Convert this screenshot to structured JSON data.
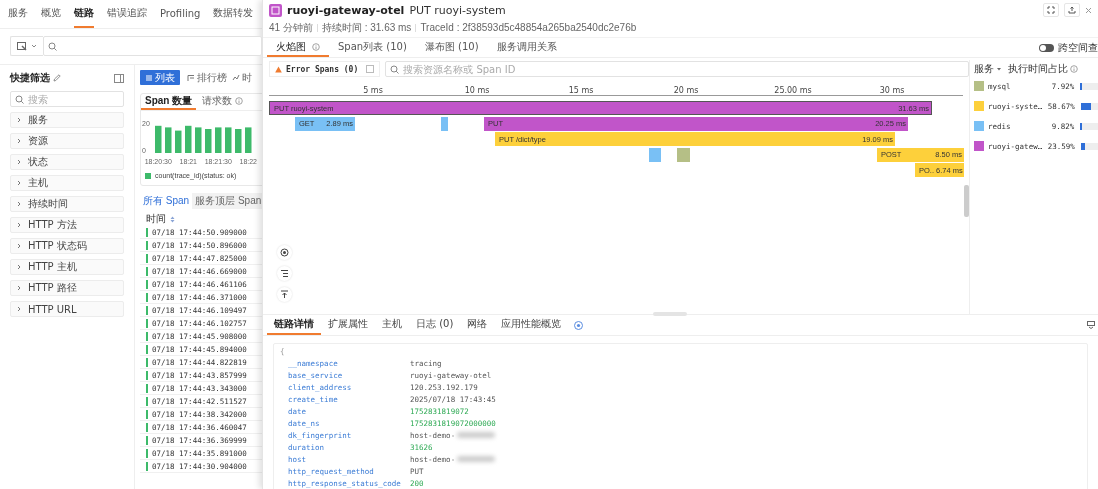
{
  "nav": {
    "tabs": [
      {
        "label": "服务",
        "selected": false
      },
      {
        "label": "概览",
        "selected": false
      },
      {
        "label": "链路",
        "selected": true
      },
      {
        "label": "错误追踪",
        "selected": false
      },
      {
        "label": "Profiling",
        "selected": false
      },
      {
        "label": "数据转发",
        "selected": false
      }
    ]
  },
  "quick_filter": {
    "title": "快捷筛选",
    "search_placeholder": "搜索",
    "items": [
      {
        "label": "服务",
        "expanded": false
      },
      {
        "label": "资源",
        "expanded": false
      },
      {
        "label": "状态",
        "expanded": false
      },
      {
        "label": "主机",
        "expanded": false
      },
      {
        "label": "持续时间",
        "expanded": false
      },
      {
        "label": "HTTP 方法",
        "expanded": false
      },
      {
        "label": "HTTP 状态码",
        "expanded": false
      },
      {
        "label": "HTTP 主机",
        "expanded": false
      },
      {
        "label": "HTTP 路径",
        "expanded": false
      },
      {
        "label": "HTTP URL",
        "expanded": false
      }
    ]
  },
  "view_buttons": [
    {
      "label": "列表",
      "selected": true
    },
    {
      "label": "排行榜",
      "selected": false
    },
    {
      "label": "时",
      "selected": false
    }
  ],
  "chart_card": {
    "tabs": [
      {
        "label": "Span 数量",
        "selected": true
      },
      {
        "label": "请求数",
        "selected": false
      }
    ],
    "chart_data": {
      "type": "bar",
      "categories": [
        "18:20:30",
        null,
        null,
        "18:21",
        null,
        null,
        "18:21:30",
        null,
        null,
        "18:22"
      ],
      "yticks": [
        0,
        20
      ],
      "ylim": [
        0,
        20
      ],
      "series": [
        {
          "name": "count(trace_id)(status: ok)",
          "color": "#3dba6a",
          "values": [
            17,
            16,
            14,
            17,
            16,
            15,
            16,
            16,
            15,
            16
          ]
        }
      ]
    }
  },
  "span_table": {
    "tabs": [
      {
        "label": "所有 Span",
        "selected": true
      },
      {
        "label": "服务顶层 Span",
        "selected": false
      }
    ],
    "columns": [
      "时间"
    ],
    "rows": [
      "07/18 17:44:50.909000",
      "07/18 17:44:50.896000",
      "07/18 17:44:47.825000",
      "07/18 17:44:46.669000",
      "07/18 17:44:46.461106",
      "07/18 17:44:46.371000",
      "07/18 17:44:46.109497",
      "07/18 17:44:46.102757",
      "07/18 17:44:45.908000",
      "07/18 17:44:45.894000",
      "07/18 17:44:44.822819",
      "07/18 17:44:43.857999",
      "07/18 17:44:43.343000",
      "07/18 17:44:42.511527",
      "07/18 17:44:38.342000",
      "07/18 17:44:36.460047",
      "07/18 17:44:36.369999",
      "07/18 17:44:35.891000",
      "07/18 17:44:30.904000"
    ]
  },
  "trace": {
    "service": "ruoyi-gateway-otel",
    "resource": "PUT ruoyi-system",
    "meta": [
      "41 分钟前",
      "持续时间 : 31.63 ms",
      "TraceId : 2f38593d5c48854a265ba2540dc2e76b"
    ],
    "tabs": [
      {
        "label": "火焰图",
        "selected": true
      },
      {
        "label": "Span列表 (10)",
        "selected": false
      },
      {
        "label": "瀑布图 (10)",
        "selected": false
      },
      {
        "label": "服务调用关系",
        "selected": false
      }
    ],
    "cross_space": {
      "label": "跨空间查",
      "on": false
    }
  },
  "flame": {
    "error_spans": {
      "label": "Error Spans (0)",
      "checked": false
    },
    "search_placeholder": "搜索资源名称或 Span ID",
    "ticks": [
      "5 ms",
      "10 ms",
      "15 ms",
      "20 ms",
      "25.00 ms",
      "30 ms"
    ],
    "spans": [
      {
        "label": "PUT ruoyi-system",
        "duration": "31.63 ms",
        "color": "#c155c9",
        "children": [
          {
            "label": "GET",
            "duration": "2.89 ms",
            "color": "#79c0f5"
          },
          {
            "color": "#79c0f5"
          },
          {
            "label": "PUT",
            "duration": "20.25 ms",
            "color": "#c155c9",
            "children": [
              {
                "label": "PUT /dict/type",
                "duration": "19.09 ms",
                "color": "#fdd03b",
                "children": [
                  {
                    "color": "#79c0f5"
                  },
                  {
                    "color": "#b5bf86"
                  },
                  {
                    "label": "POST",
                    "duration": "8.50 ms",
                    "color": "#fdd03b",
                    "children": [
                      {
                        "label": "PO..",
                        "duration": "6.74 ms",
                        "color": "#fdd03b"
                      }
                    ]
                  }
                ]
              }
            ]
          }
        ]
      }
    ]
  },
  "services": {
    "columns": [
      "服务",
      "执行时间占比"
    ],
    "rows": [
      {
        "name": "mysql",
        "share": "7.92%",
        "level": 0.0792,
        "color": "#b5bf86"
      },
      {
        "name": "ruoyi-syste…",
        "share": "58.67%",
        "level": 0.5867,
        "color": "#fdd03b"
      },
      {
        "name": "redis",
        "share": "9.82%",
        "level": 0.0982,
        "color": "#79c0f5"
      },
      {
        "name": "ruoyi-gatew…",
        "share": "23.59%",
        "level": 0.2359,
        "color": "#c155c9"
      }
    ]
  },
  "details": {
    "tabs": [
      {
        "label": "链路详情",
        "selected": true
      },
      {
        "label": "扩展属性",
        "selected": false
      },
      {
        "label": "主机",
        "selected": false
      },
      {
        "label": "日志 (0)",
        "selected": false
      },
      {
        "label": "网络",
        "selected": false
      },
      {
        "label": "应用性能概览",
        "selected": false
      }
    ],
    "open_brace": "{",
    "fields": [
      {
        "key": "__namespace",
        "value": "tracing",
        "kind": "string"
      },
      {
        "key": "base_service",
        "value": "ruoyi-gateway-otel",
        "kind": "string"
      },
      {
        "key": "client_address",
        "value": "120.253.192.179",
        "kind": "string"
      },
      {
        "key": "create_time",
        "value": "2025/07/18 17:43:45",
        "kind": "string"
      },
      {
        "key": "date",
        "value": "1752831819072",
        "kind": "number"
      },
      {
        "key": "date_ns",
        "value": "1752831819072000000",
        "kind": "number"
      },
      {
        "key": "dk_fingerprint",
        "value": "host-demo-",
        "kind": "string",
        "redacted": true
      },
      {
        "key": "duration",
        "value": "31626",
        "kind": "number"
      },
      {
        "key": "host",
        "value": "host-demo-",
        "kind": "string",
        "redacted": true
      },
      {
        "key": "http_request_method",
        "value": "PUT",
        "kind": "string"
      },
      {
        "key": "http_response_status_code",
        "value": "200",
        "kind": "number"
      }
    ]
  }
}
